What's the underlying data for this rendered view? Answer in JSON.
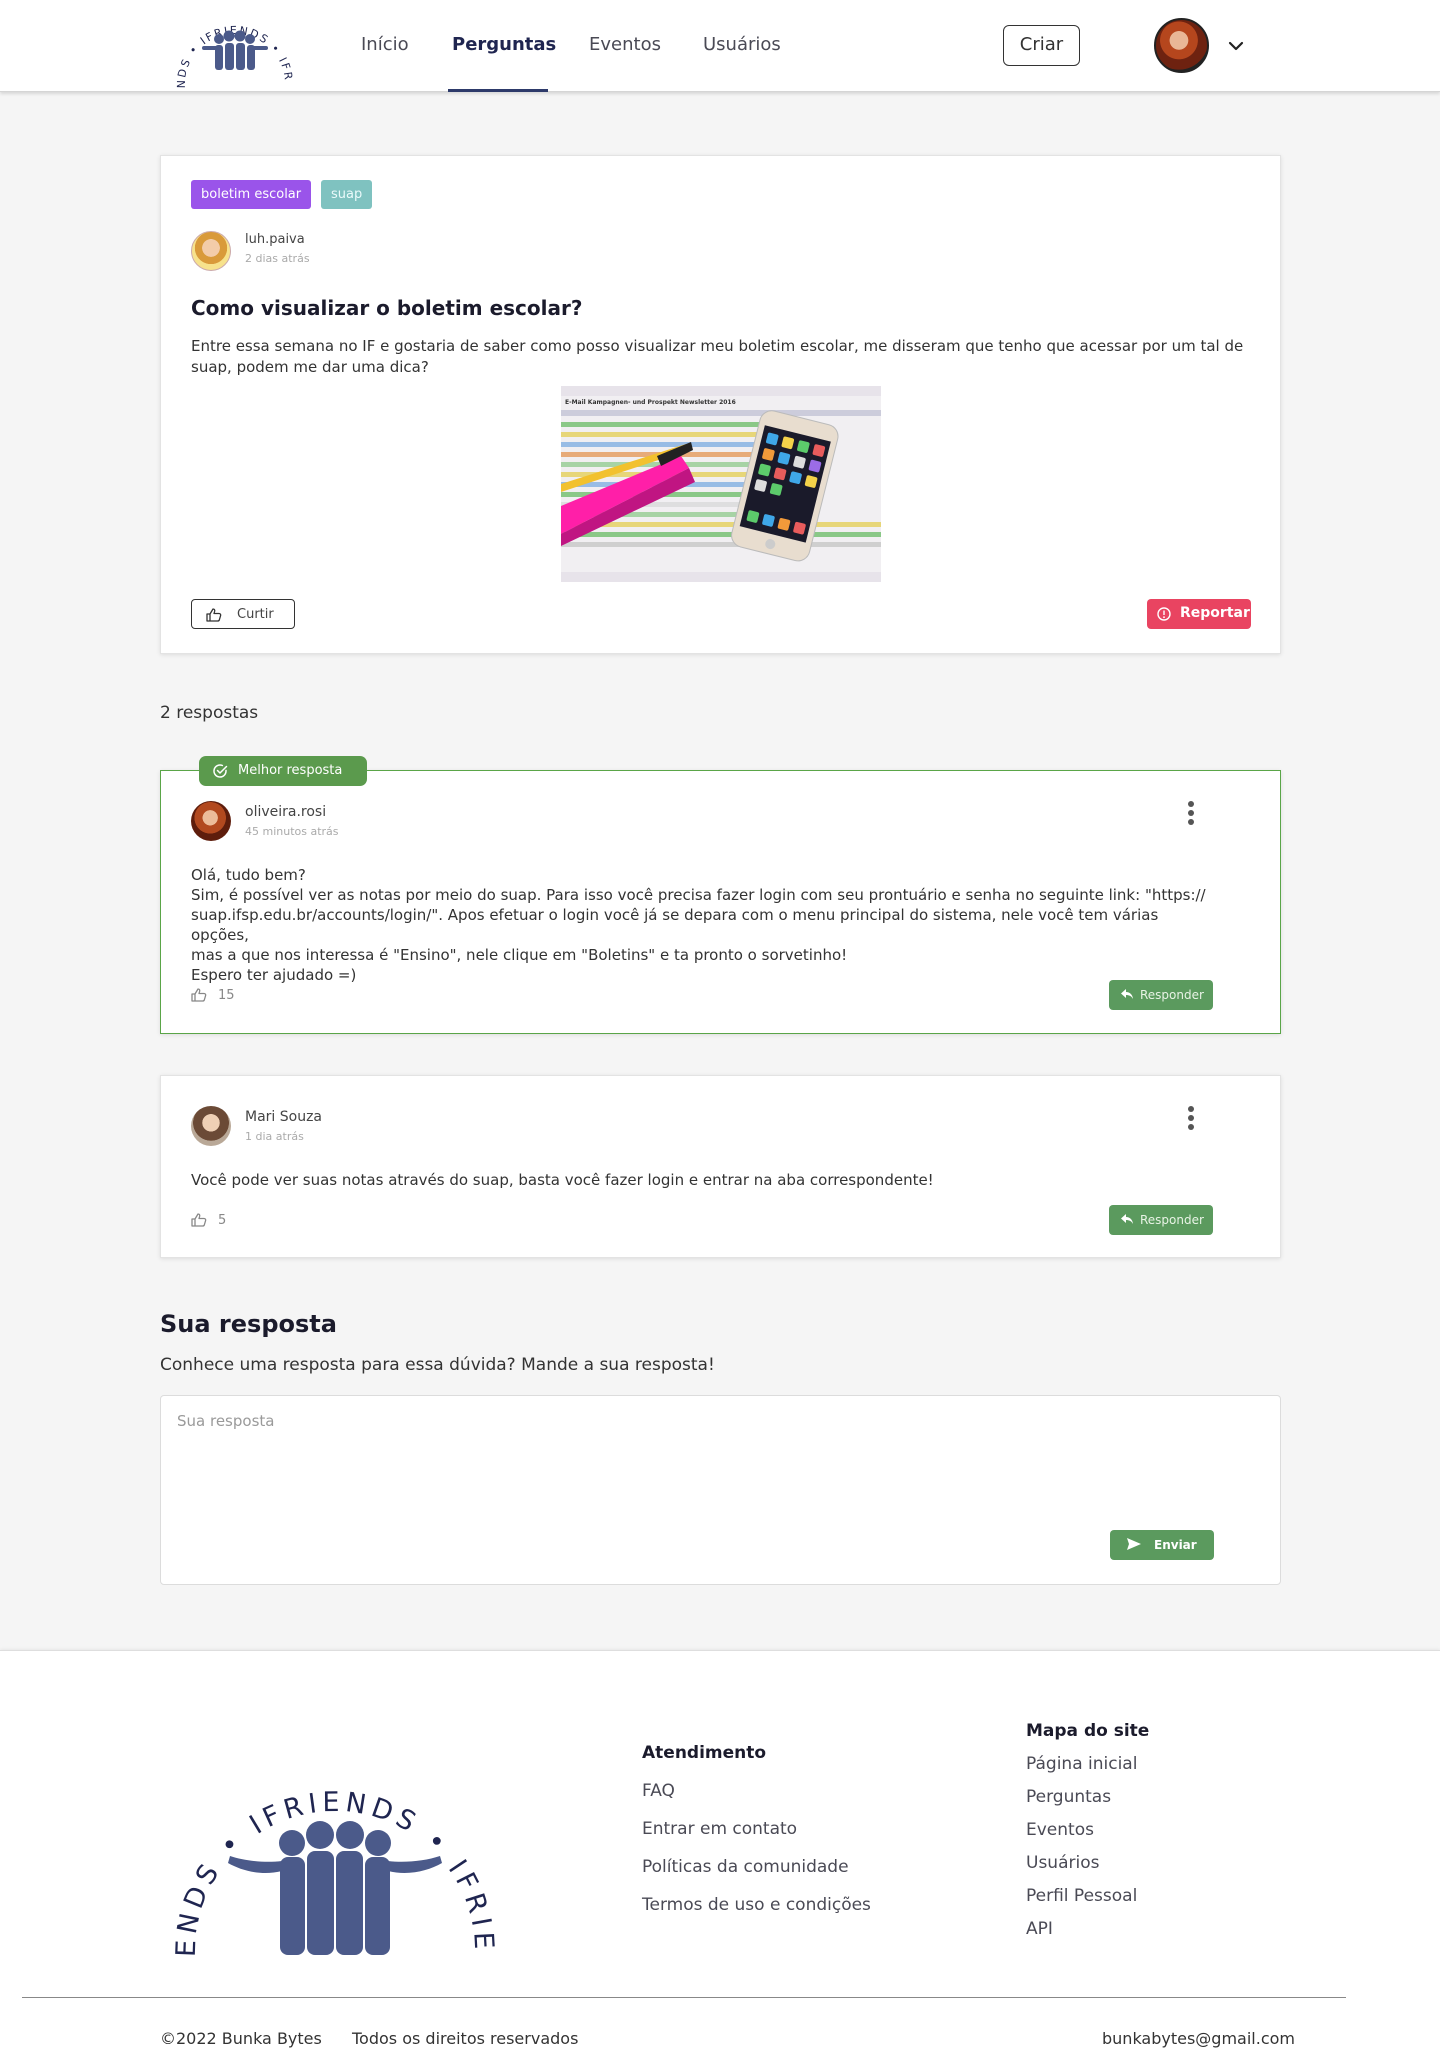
{
  "header": {
    "nav": [
      "Início",
      "Perguntas",
      "Eventos",
      "Usuários"
    ],
    "active": "Perguntas",
    "create_label": "Criar",
    "logo_text": "IFRIENDS"
  },
  "question": {
    "tags": [
      "boletim escolar",
      "suap"
    ],
    "author": "luh.paiva",
    "time": "2 dias atrás",
    "title": "Como visualizar o boletim escolar?",
    "body": "Entre essa semana no IF e gostaria de saber como posso visualizar meu boletim escolar, me disseram que tenho que acessar por um tal de suap, podem me dar uma dica?",
    "image_caption": "E-Mail Kampagnen- und Prospekt Newsletter 2016",
    "like_label": "Curtir",
    "report_label": "Reportar"
  },
  "responses_count": "2 respostas",
  "answers": [
    {
      "best_label": "Melhor resposta",
      "author": "oliveira.rosi",
      "time": "45 minutos atrás",
      "body_lines": [
        "Olá, tudo bem?",
        "Sim, é possível ver as notas por meio do suap. Para isso você precisa fazer login com seu prontuário e senha no seguinte link: \"https://",
        "suap.ifsp.edu.br/accounts/login/\". Apos efetuar o login você já se depara com o menu principal do sistema, nele você tem várias opções,",
        "mas a que nos interessa é  \"Ensino\", nele clique em \"Boletins\" e ta pronto o sorvetinho!",
        "Espero ter ajudado =)"
      ],
      "likes": "15",
      "reply_label": "Responder"
    },
    {
      "author": "Mari Souza",
      "time": "1 dia atrás",
      "body": "Você pode ver suas notas através do suap, basta você fazer login e entrar na aba correspondente!",
      "likes": "5",
      "reply_label": "Responder"
    }
  ],
  "your_answer": {
    "title": "Sua resposta",
    "subtitle": "Conhece uma resposta para essa dúvida? Mande a sua resposta!",
    "placeholder": "Sua resposta",
    "send_label": "Enviar"
  },
  "footer": {
    "logo_text": "IFRIENDS",
    "atendimento_title": "Atendimento",
    "atendimento_links": [
      "FAQ",
      "Entrar em contato",
      "Políticas da comunidade",
      "Termos de uso e condições"
    ],
    "mapa_title": "Mapa do site",
    "mapa_links": [
      "Página inicial",
      "Perguntas",
      "Eventos",
      "Usuários",
      "Perfil Pessoal",
      "API"
    ],
    "copyright": "©2022 Bunka Bytes",
    "rights": "Todos os direitos reservados",
    "email": "bunkabytes@gmail.com"
  },
  "colors": {
    "brand": "#4b5a8a",
    "tag_purple": "#9a54ea",
    "tag_teal": "#7fc2c0",
    "report_red": "#e94461",
    "success_green": "#5b9a5e",
    "best_border": "#5aa548"
  }
}
